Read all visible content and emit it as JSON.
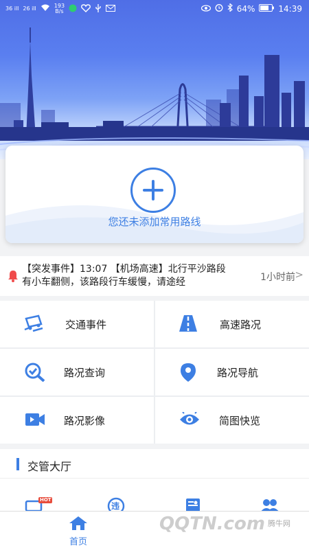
{
  "statusbar": {
    "signal1": "36 ill",
    "signal2": "26 ill",
    "speed_value": "193",
    "speed_unit": "B/s",
    "battery": "64%",
    "time": "14:39"
  },
  "route_card": {
    "empty_text": "您还未添加常用路线"
  },
  "notice": {
    "text": "【突发事件】13:07 【机场高速】北行平沙路段有小车翻侧，该路段行车缓慢，请途经",
    "time": "1小时前"
  },
  "menu": [
    {
      "label": "交通事件",
      "icon": "car-crash-icon"
    },
    {
      "label": "高速路况",
      "icon": "highway-icon"
    },
    {
      "label": "路况查询",
      "icon": "search-check-icon"
    },
    {
      "label": "路况导航",
      "icon": "location-pin-icon"
    },
    {
      "label": "路况影像",
      "icon": "video-camera-icon"
    },
    {
      "label": "简图快览",
      "icon": "eye-icon"
    }
  ],
  "section": {
    "title": "交管大厅",
    "hot_badge": "HOT",
    "violation_icon_char": "违"
  },
  "tabbar": {
    "home_label": "首页"
  },
  "watermark": {
    "text": "QQTN.com",
    "small": "腾牛网"
  },
  "colors": {
    "accent": "#3d7fe3"
  }
}
